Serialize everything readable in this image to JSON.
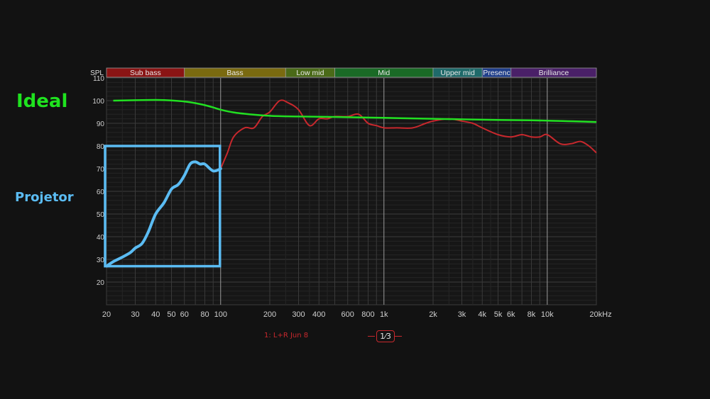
{
  "annotations": {
    "ideal": "Ideal",
    "projector": "Projetor"
  },
  "legend": {
    "trace": "1: L+R Jun 8"
  },
  "smoothing": {
    "label": "1⁄3"
  },
  "colors": {
    "background": "#121212",
    "plot_bg": "#161616",
    "grid": "#3a3a3a",
    "ideal": "#22e022",
    "measured": "#c8282d",
    "highlight": "#5bbcf3"
  },
  "chart_data": {
    "type": "line",
    "xscale": "log",
    "xlim": [
      20,
      20000
    ],
    "ylim": [
      10,
      110
    ],
    "ylabel": "SPL",
    "y_ticks": [
      20,
      30,
      40,
      50,
      60,
      70,
      80,
      90,
      100,
      110
    ],
    "x_ticks": [
      {
        "v": 20,
        "label": "20"
      },
      {
        "v": 30,
        "label": "30"
      },
      {
        "v": 40,
        "label": "40"
      },
      {
        "v": 50,
        "label": "50"
      },
      {
        "v": 60,
        "label": "60"
      },
      {
        "v": 80,
        "label": "80"
      },
      {
        "v": 100,
        "label": "100"
      },
      {
        "v": 200,
        "label": "200"
      },
      {
        "v": 300,
        "label": "300"
      },
      {
        "v": 400,
        "label": "400"
      },
      {
        "v": 600,
        "label": "600"
      },
      {
        "v": 800,
        "label": "800"
      },
      {
        "v": 1000,
        "label": "1k"
      },
      {
        "v": 2000,
        "label": "2k"
      },
      {
        "v": 3000,
        "label": "3k"
      },
      {
        "v": 4000,
        "label": "4k"
      },
      {
        "v": 5000,
        "label": "5k"
      },
      {
        "v": 6000,
        "label": "6k"
      },
      {
        "v": 8000,
        "label": "8k"
      },
      {
        "v": 10000,
        "label": "10k"
      },
      {
        "v": 20000,
        "label": "20kHz"
      }
    ],
    "bands": [
      {
        "label": "Sub bass",
        "from": 20,
        "to": 60,
        "color": "#8a1414"
      },
      {
        "label": "Bass",
        "from": 60,
        "to": 250,
        "color": "#7a6a10"
      },
      {
        "label": "Low mid",
        "from": 250,
        "to": 500,
        "color": "#4a6a18"
      },
      {
        "label": "Mid",
        "from": 500,
        "to": 2000,
        "color": "#1a6a26"
      },
      {
        "label": "Upper mid",
        "from": 2000,
        "to": 4000,
        "color": "#1f6a6a"
      },
      {
        "label": "Presenc",
        "from": 4000,
        "to": 6000,
        "color": "#1f3e8a"
      },
      {
        "label": "Brilliance",
        "from": 6000,
        "to": 20000,
        "color": "#4a2068"
      }
    ],
    "series": [
      {
        "name": "1: L+R Jun 8",
        "color": "#c8282d",
        "x": [
          20,
          22,
          25,
          28,
          30,
          33,
          36,
          40,
          45,
          50,
          55,
          60,
          65,
          70,
          75,
          80,
          90,
          100,
          110,
          120,
          140,
          160,
          180,
          200,
          230,
          260,
          300,
          350,
          400,
          450,
          500,
          600,
          700,
          800,
          900,
          1000,
          1200,
          1500,
          1800,
          2000,
          2500,
          3000,
          3500,
          4000,
          5000,
          6000,
          7000,
          8000,
          9000,
          10000,
          12000,
          14000,
          16000,
          18000,
          20000
        ],
        "y": [
          27,
          29,
          31,
          33,
          35,
          37,
          42,
          50,
          55,
          61,
          63,
          67,
          72,
          73,
          72,
          72,
          69,
          70,
          77,
          84,
          88,
          88,
          93,
          95,
          100,
          99,
          96,
          89,
          92,
          92,
          93,
          93,
          94,
          90,
          89,
          88,
          88,
          88,
          90,
          91,
          92,
          91,
          90,
          88,
          85,
          84,
          85,
          84,
          84,
          85,
          81,
          81,
          82,
          80,
          77
        ]
      },
      {
        "name": "",
        "color": "#22e022",
        "x": [
          22,
          30,
          40,
          50,
          60,
          70,
          80,
          90,
          100,
          120,
          150,
          200,
          300,
          500,
          1000,
          2000,
          5000,
          10000,
          20000
        ],
        "y": [
          100,
          100.2,
          100.3,
          100.1,
          99.6,
          98.9,
          98,
          97,
          96,
          94.8,
          94,
          93.3,
          93,
          92.8,
          92.4,
          92,
          91.5,
          91.2,
          90.6
        ]
      }
    ],
    "highlight_box": {
      "x_from": 20,
      "x_to": 100,
      "y_from": 27,
      "y_to": 80
    }
  }
}
